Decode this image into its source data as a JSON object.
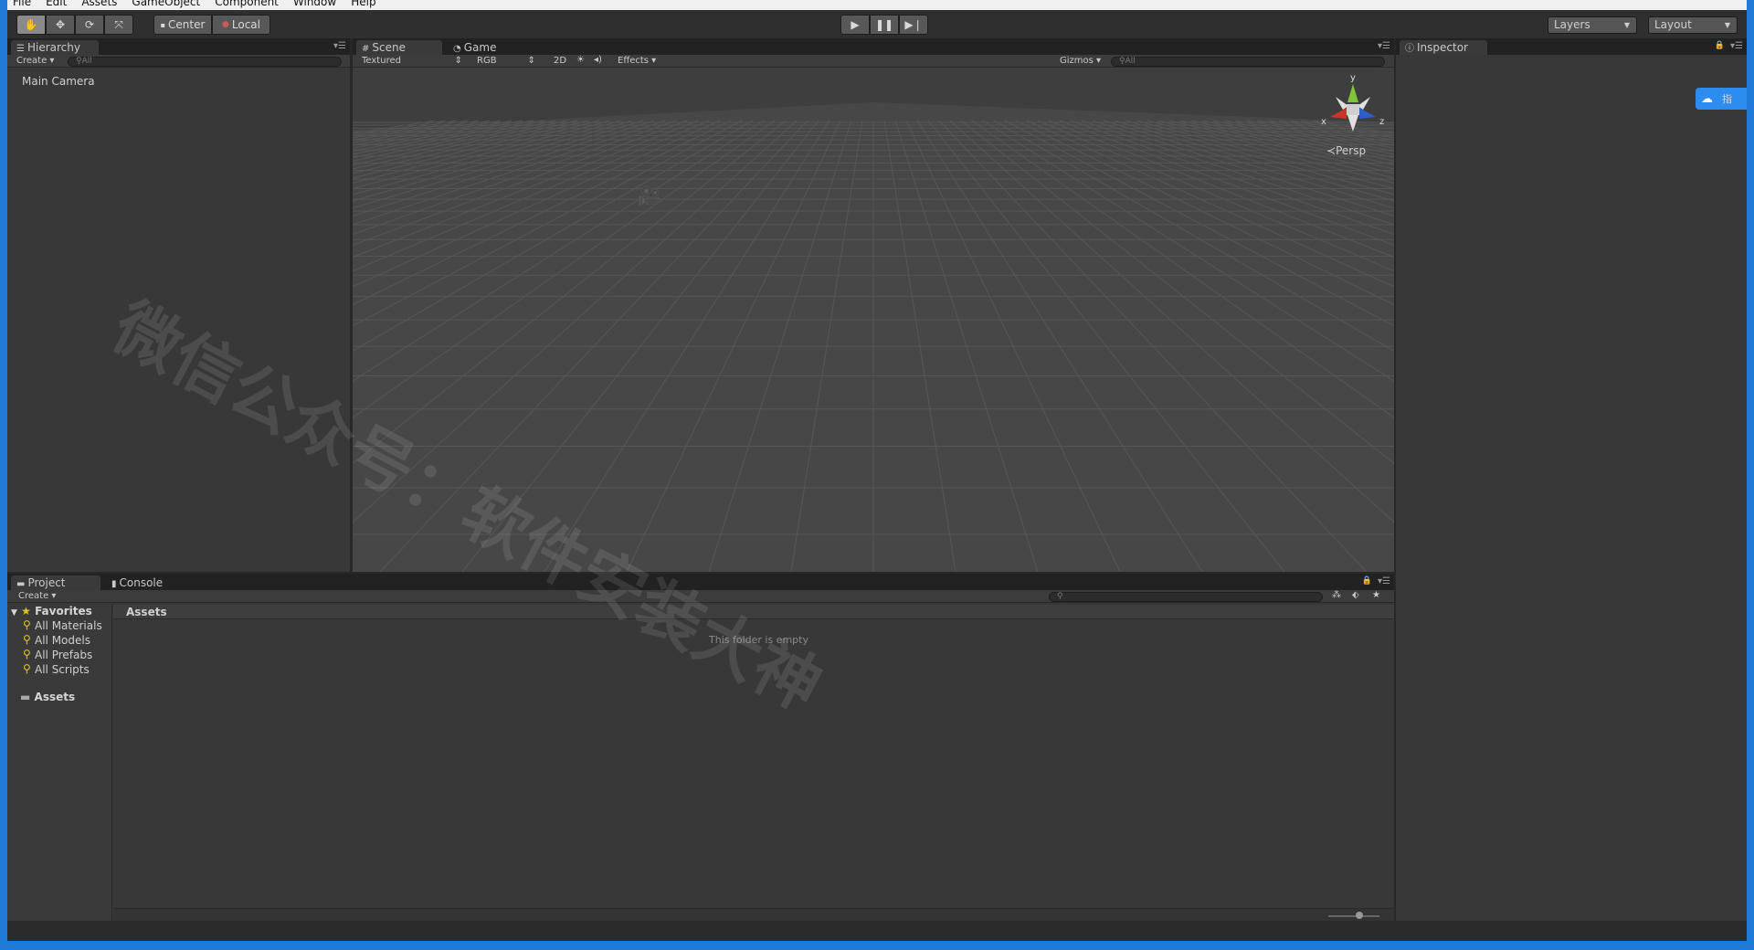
{
  "menu": [
    "File",
    "Edit",
    "Assets",
    "GameObject",
    "Component",
    "Window",
    "Help"
  ],
  "toolbar": {
    "center_label": "Center",
    "local_label": "Local",
    "layers_label": "Layers",
    "layout_label": "Layout"
  },
  "hierarchy": {
    "tab": "Hierarchy",
    "create": "Create",
    "search_placeholder": "All",
    "items": [
      "Main Camera"
    ]
  },
  "scene": {
    "tabs": [
      "Scene",
      "Game"
    ],
    "shading": "Textured",
    "color": "RGB",
    "mode2d": "2D",
    "effects": "Effects",
    "gizmos": "Gizmos",
    "search_placeholder": "All",
    "persp": "Persp",
    "axis_x": "x",
    "axis_y": "y",
    "axis_z": "z"
  },
  "inspector": {
    "tab": "Inspector"
  },
  "project": {
    "tabs": [
      "Project",
      "Console"
    ],
    "create": "Create",
    "favorites_label": "Favorites",
    "favorites": [
      "All Materials",
      "All Models",
      "All Prefabs",
      "All Scripts"
    ],
    "assets_label": "Assets",
    "breadcrumb": "Assets",
    "empty_message": "This folder is empty"
  },
  "watermark": "微信公众号：软件安装大神",
  "sidebadge_text": "指"
}
